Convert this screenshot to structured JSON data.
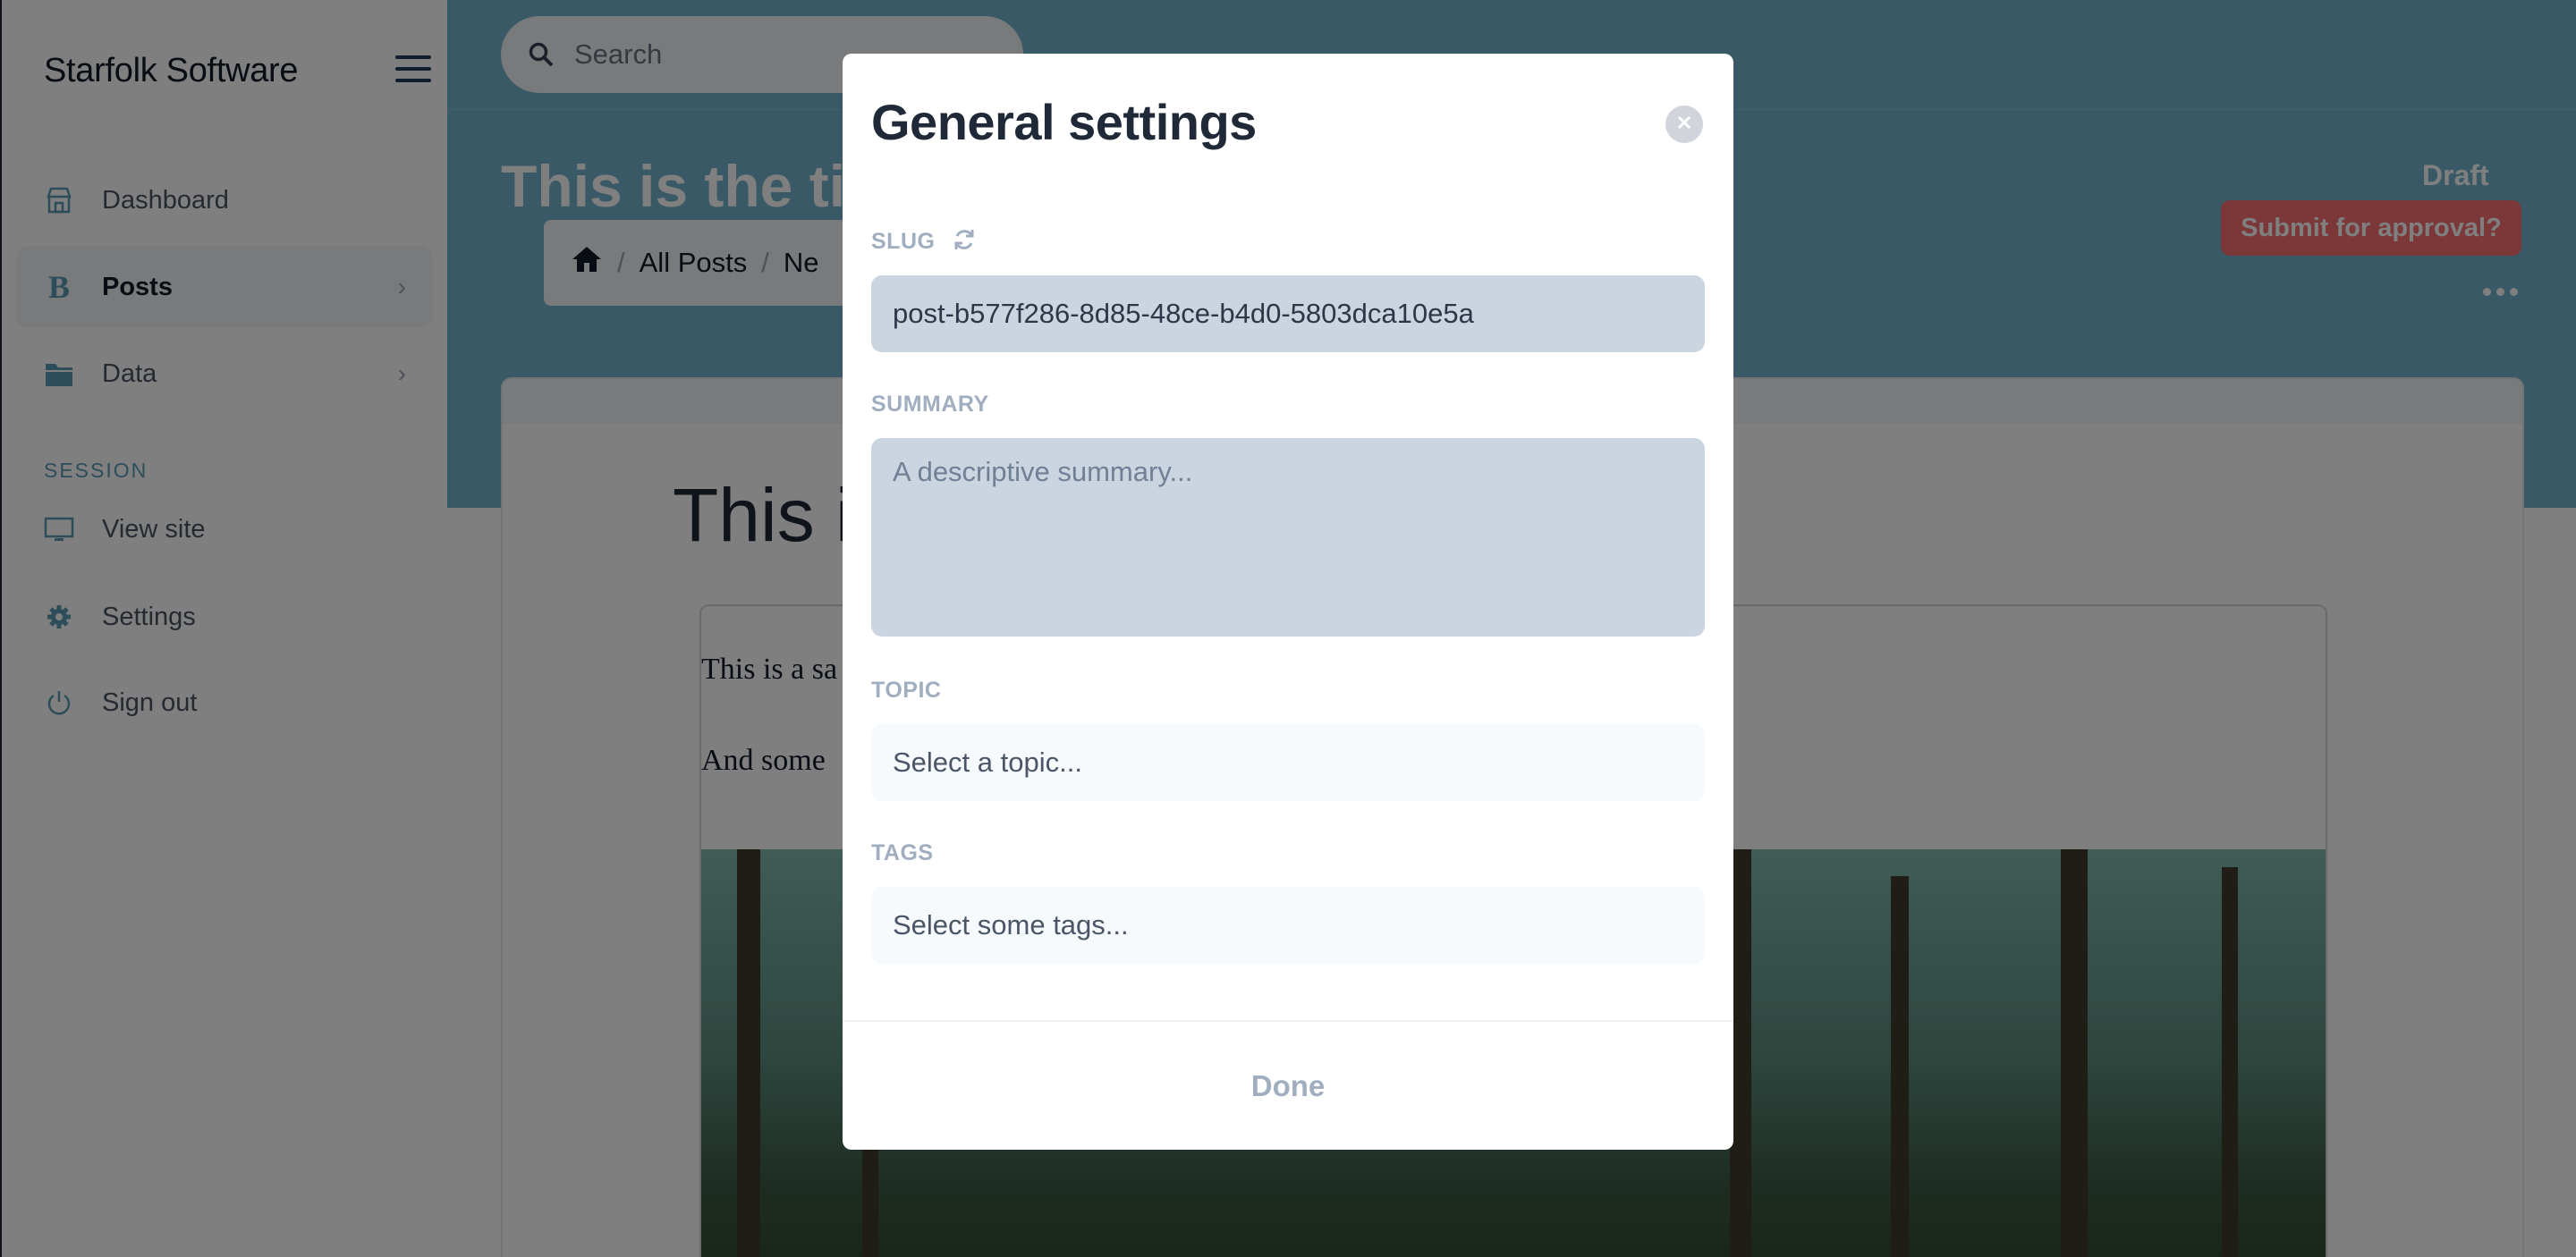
{
  "sidebar": {
    "brand": "Starfolk Software",
    "items": [
      {
        "label": "Dashboard",
        "icon": "store-icon"
      },
      {
        "label": "Posts",
        "icon": "blog-b-icon"
      },
      {
        "label": "Data",
        "icon": "folder-icon"
      }
    ],
    "session_label": "SESSION",
    "session_items": [
      {
        "label": "View site",
        "icon": "monitor-icon"
      },
      {
        "label": "Settings",
        "icon": "gear-icon"
      },
      {
        "label": "Sign out",
        "icon": "power-icon"
      }
    ]
  },
  "header": {
    "search_placeholder": "Search",
    "page_title": "This is the title",
    "breadcrumb": [
      "All Posts",
      "Ne"
    ],
    "status": "Draft",
    "approve_button": "Submit for approval?"
  },
  "editor": {
    "post_title": "This i",
    "paragraph_1": "This is a sa",
    "paragraph_2": "And some"
  },
  "modal": {
    "title": "General settings",
    "slug_label": "SLUG",
    "slug_value": "post-b577f286-8d85-48ce-b4d0-5803dca10e5a",
    "summary_label": "SUMMARY",
    "summary_placeholder": "A descriptive summary...",
    "topic_label": "TOPIC",
    "topic_placeholder": "Select a topic...",
    "tags_label": "TAGS",
    "tags_placeholder": "Select some tags...",
    "done_label": "Done"
  },
  "colors": {
    "accent": "#73b3cf",
    "danger": "#f87171",
    "sidebar_icon": "#5b9bb5"
  }
}
